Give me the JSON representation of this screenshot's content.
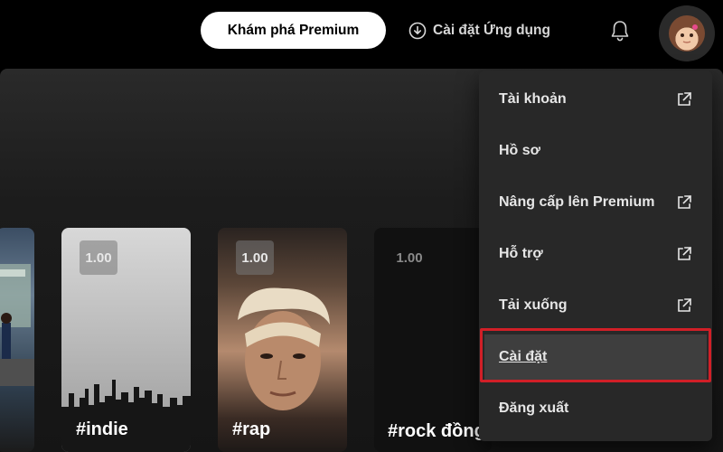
{
  "header": {
    "premium_button": "Khám phá Premium",
    "install_button": "Cài đặt Ứng dụng",
    "icons": {
      "install": "download-circle-icon",
      "notifications": "bell-icon",
      "avatar": "user-avatar"
    }
  },
  "cards": [
    {
      "title": "",
      "badge": ""
    },
    {
      "title": "#indie",
      "badge": "1.00"
    },
    {
      "title": "#rap",
      "badge": "1.00"
    },
    {
      "title": "#rock đồng quê",
      "badge": "1.00"
    }
  ],
  "menu": {
    "items": [
      {
        "label": "Tài khoản",
        "external": true
      },
      {
        "label": "Hồ sơ",
        "external": false
      },
      {
        "label": "Nâng cấp lên Premium",
        "external": true
      },
      {
        "label": "Hỗ trợ",
        "external": true
      },
      {
        "label": "Tải xuống",
        "external": true
      },
      {
        "label": "Cài đặt",
        "external": false,
        "highlighted": true
      },
      {
        "label": "Đăng xuất",
        "external": false
      }
    ],
    "highlight_color": "#d11f27"
  }
}
